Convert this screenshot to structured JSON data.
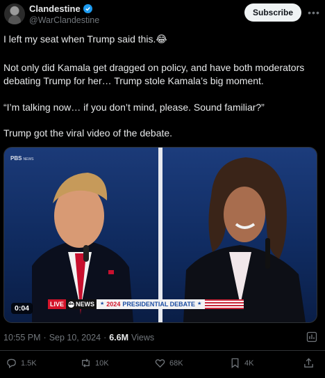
{
  "author": {
    "display_name": "Clandestine",
    "handle": "@WarClandestine",
    "verified": true,
    "avatar_icon": "profile-avatar"
  },
  "header": {
    "subscribe_label": "Subscribe",
    "more_icon": "more-dots-icon"
  },
  "post": {
    "paragraphs": [
      "I left my seat when Trump said this.😂",
      "Not only did Kamala get dragged on policy, and have both moderators debating Trump for her… Trump stole Kamala’s big moment.",
      "“I’m talking now… if you don’t mind, please. Sound familiar?”",
      "Trump got the viral video of the debate."
    ]
  },
  "media": {
    "duration": "0:04",
    "pbs_watermark": "PBS",
    "pbs_sub": "NEWS",
    "chyron": {
      "live": "LIVE",
      "network": "NEWS",
      "year": "2024",
      "title": "PRESIDENTIAL DEBATE"
    }
  },
  "meta": {
    "time": "10:55 PM",
    "date": "Sep 10, 2024",
    "dot": "·",
    "views_count": "6.6M",
    "views_label": "Views"
  },
  "actions": {
    "replies": "1.5K",
    "reposts": "10K",
    "likes": "68K",
    "bookmarks": "4K"
  },
  "colors": {
    "background": "#000000",
    "text": "#e7e9ea",
    "muted": "#71767b",
    "verified": "#1d9bf0",
    "live_red": "#d4142a",
    "debate_blue": "#1e4fa3"
  }
}
